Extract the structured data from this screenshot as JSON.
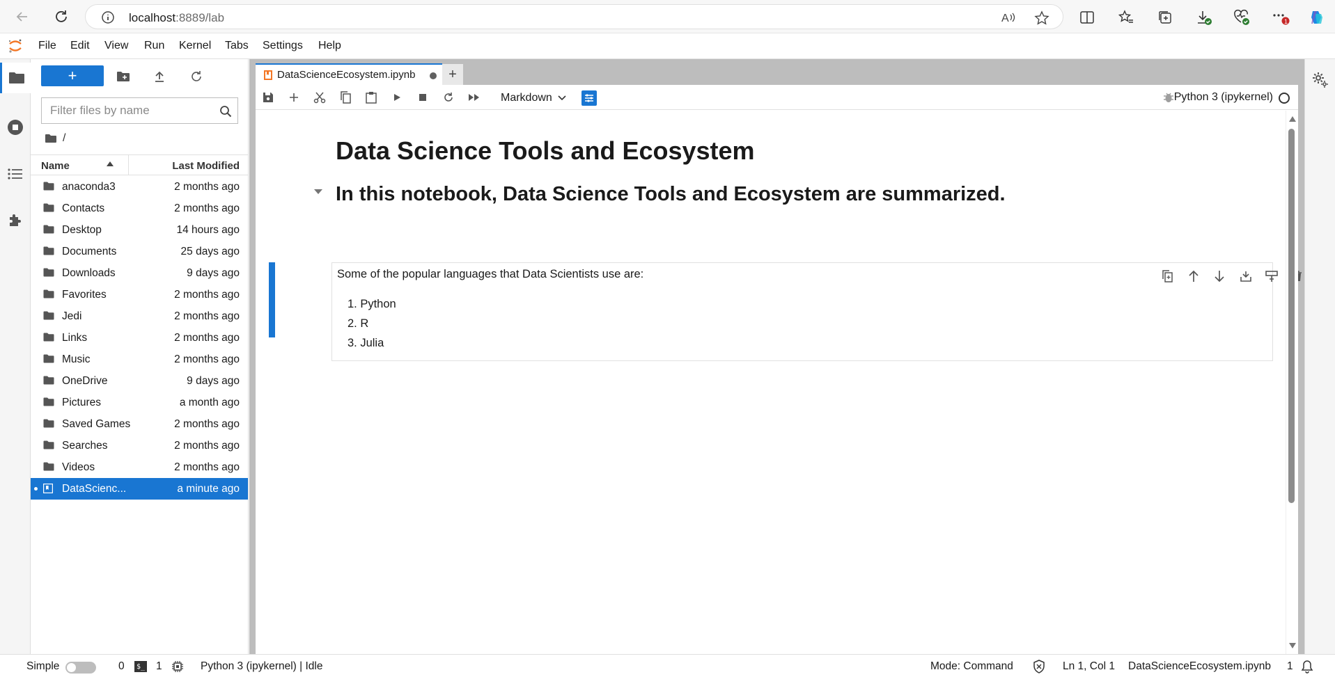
{
  "browser": {
    "url_host": "localhost",
    "url_path": ":8889/lab"
  },
  "menu": [
    "File",
    "Edit",
    "View",
    "Run",
    "Kernel",
    "Tabs",
    "Settings",
    "Help"
  ],
  "filebrowser": {
    "new_label": "+",
    "filter_placeholder": "Filter files by name",
    "breadcrumb": "/",
    "col_name": "Name",
    "col_modified": "Last Modified",
    "items": [
      {
        "name": "anaconda3",
        "modified": "2 months ago",
        "type": "folder"
      },
      {
        "name": "Contacts",
        "modified": "2 months ago",
        "type": "folder"
      },
      {
        "name": "Desktop",
        "modified": "14 hours ago",
        "type": "folder"
      },
      {
        "name": "Documents",
        "modified": "25 days ago",
        "type": "folder"
      },
      {
        "name": "Downloads",
        "modified": "9 days ago",
        "type": "folder"
      },
      {
        "name": "Favorites",
        "modified": "2 months ago",
        "type": "folder"
      },
      {
        "name": "Jedi",
        "modified": "2 months ago",
        "type": "folder"
      },
      {
        "name": "Links",
        "modified": "2 months ago",
        "type": "folder"
      },
      {
        "name": "Music",
        "modified": "2 months ago",
        "type": "folder"
      },
      {
        "name": "OneDrive",
        "modified": "9 days ago",
        "type": "folder"
      },
      {
        "name": "Pictures",
        "modified": "a month ago",
        "type": "folder"
      },
      {
        "name": "Saved Games",
        "modified": "2 months ago",
        "type": "folder"
      },
      {
        "name": "Searches",
        "modified": "2 months ago",
        "type": "folder"
      },
      {
        "name": "Videos",
        "modified": "2 months ago",
        "type": "folder"
      },
      {
        "name": "DataScienc...",
        "modified": "a minute ago",
        "type": "notebook",
        "selected": true
      }
    ]
  },
  "tab": {
    "name": "DataScienceEcosystem.ipynb",
    "add_label": "+"
  },
  "toolbar": {
    "cell_type": "Markdown",
    "kernel": "Python 3 (ipykernel)"
  },
  "notebook": {
    "h1": "Data Science Tools and Ecosystem",
    "h2": "In this notebook, Data Science Tools and Ecosystem are summarized.",
    "cell_intro": "Some of the popular languages that Data Scientists use are:",
    "languages": [
      "1. Python",
      "2. R",
      "3. Julia"
    ]
  },
  "statusbar": {
    "simple": "Simple",
    "count_a": "0",
    "count_b": "1",
    "kernel_status": "Python 3 (ipykernel) | Idle",
    "mode": "Mode: Command",
    "position": "Ln 1, Col 1",
    "filename": "DataScienceEcosystem.ipynb",
    "count_c": "1"
  },
  "colors": {
    "accent": "#1976d2",
    "panel": "#bdbdbd"
  }
}
